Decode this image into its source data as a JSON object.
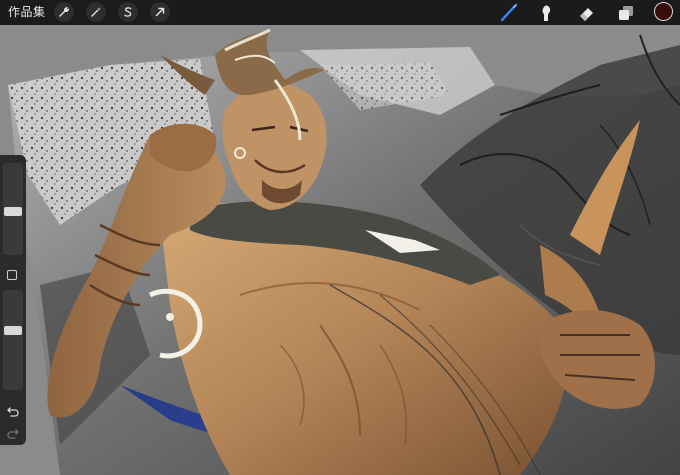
{
  "topbar": {
    "gallery_label": "作品集",
    "left_tools": [
      {
        "name": "actions",
        "icon": "wrench-icon"
      },
      {
        "name": "adjustments",
        "icon": "magic-wand-icon"
      },
      {
        "name": "selection",
        "icon": "selection-s-icon"
      },
      {
        "name": "transform",
        "icon": "arrow-cursor-icon"
      }
    ],
    "right_tools": [
      {
        "name": "brush",
        "icon": "brush-icon",
        "active": true
      },
      {
        "name": "smudge",
        "icon": "smudge-icon",
        "active": false
      },
      {
        "name": "eraser",
        "icon": "eraser-icon",
        "active": false
      },
      {
        "name": "layers",
        "icon": "layers-icon",
        "active": false
      }
    ],
    "current_color": "#3a0d0d",
    "active_color": "#3b82f6"
  },
  "sidebar": {
    "brush_size_level": 0.33,
    "opacity_level": 0.5,
    "buttons": [
      "modify-button",
      "undo-button",
      "redo-button"
    ]
  },
  "canvas": {
    "artwork": "digital-painting-illustration"
  },
  "colors": {
    "toolbar_bg": "#1b1b1b",
    "canvas_bg": "#8b8b8b",
    "skin": "#b98a5c",
    "sketch": "#2f2f2f"
  }
}
